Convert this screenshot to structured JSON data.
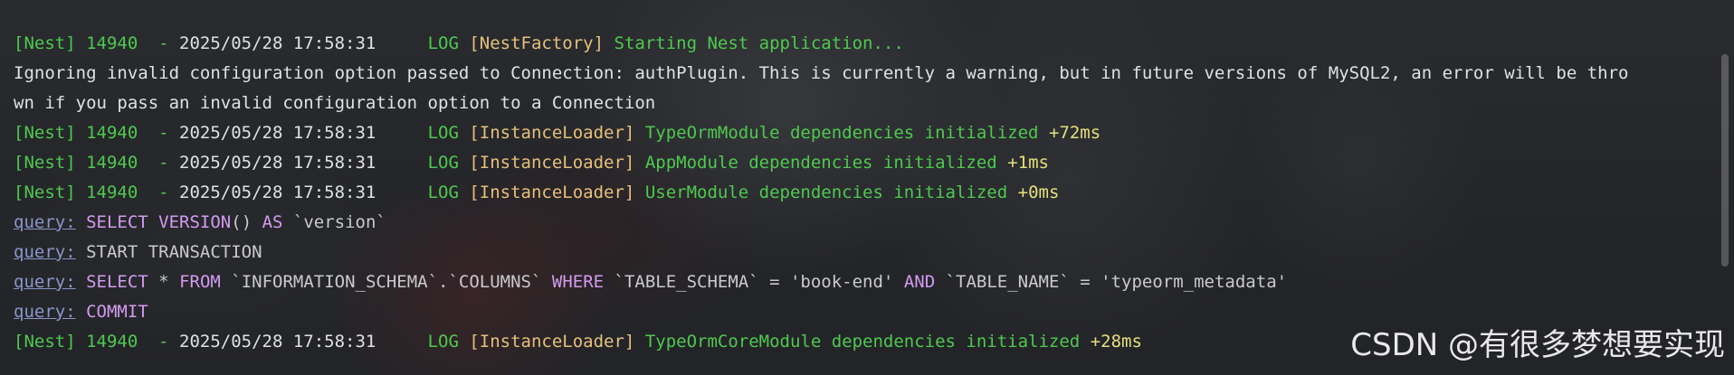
{
  "lines": [
    {
      "nest": "[Nest] 14940  - ",
      "date": "2025/05/28 17:58:31     ",
      "level": "LOG ",
      "ctx": "[NestFactory] ",
      "msg": "Starting Nest application...",
      "ms": ""
    },
    {
      "text": "Ignoring invalid configuration option passed to Connection: authPlugin. This is currently a warning, but in future versions of MySQL2, an error will be thro"
    },
    {
      "text": "wn if you pass an invalid configuration option to a Connection"
    },
    {
      "nest": "[Nest] 14940  - ",
      "date": "2025/05/28 17:58:31     ",
      "level": "LOG ",
      "ctx": "[InstanceLoader] ",
      "msg": "TypeOrmModule dependencies initialized ",
      "ms": "+72ms"
    },
    {
      "nest": "[Nest] 14940  - ",
      "date": "2025/05/28 17:58:31     ",
      "level": "LOG ",
      "ctx": "[InstanceLoader] ",
      "msg": "AppModule dependencies initialized ",
      "ms": "+1ms"
    },
    {
      "nest": "[Nest] 14940  - ",
      "date": "2025/05/28 17:58:31     ",
      "level": "LOG ",
      "ctx": "[InstanceLoader] ",
      "msg": "UserModule dependencies initialized ",
      "ms": "+0ms"
    },
    {
      "query": "query:",
      "parts": [
        "SELECT ",
        "VERSION",
        "() ",
        "AS",
        " `version`"
      ]
    },
    {
      "query": "query:",
      "parts": [
        "START TRANSACTION"
      ]
    },
    {
      "query": "query:",
      "parts": [
        "SELECT",
        " * ",
        "FROM",
        " `INFORMATION_SCHEMA`.`COLUMNS` ",
        "WHERE",
        " `TABLE_SCHEMA` = 'book-end' ",
        "AND",
        " `TABLE_NAME` = 'typeorm_metadata'"
      ]
    },
    {
      "query": "query:",
      "parts": [
        "COMMIT"
      ]
    },
    {
      "nest": "[Nest] 14940  - ",
      "date": "2025/05/28 17:58:31     ",
      "level": "LOG ",
      "ctx": "[InstanceLoader] ",
      "msg": "TypeOrmCoreModule dependencies initialized ",
      "ms": "+28ms"
    }
  ],
  "watermark": "CSDN @有很多梦想要实现",
  "colors": {
    "green": "#4ec94e",
    "yellow": "#e5c07b",
    "keyword": "#d39bf0",
    "link": "#8a96c8",
    "text": "#dfe1e5"
  }
}
